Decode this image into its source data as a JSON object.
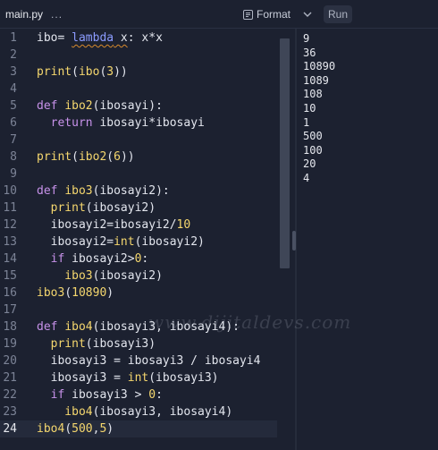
{
  "tab": {
    "filename": "main.py",
    "more": "...",
    "caret": "⌄"
  },
  "toolbar": {
    "format_label": "Format",
    "run_label": "Run"
  },
  "editor": {
    "lines": [
      {
        "n": "1",
        "tokens": [
          {
            "t": "ibo",
            "c": "op"
          },
          {
            "t": "= ",
            "c": "op"
          },
          {
            "t": "lambda",
            "c": "lam sq"
          },
          {
            "t": " x",
            "c": "op sq"
          },
          {
            "t": ": x*x",
            "c": "op"
          }
        ]
      },
      {
        "n": "2",
        "tokens": []
      },
      {
        "n": "3",
        "tokens": [
          {
            "t": "print",
            "c": "fn"
          },
          {
            "t": "(",
            "c": "op"
          },
          {
            "t": "ibo",
            "c": "fn"
          },
          {
            "t": "(",
            "c": "op"
          },
          {
            "t": "3",
            "c": "num"
          },
          {
            "t": "))",
            "c": "op"
          }
        ]
      },
      {
        "n": "4",
        "tokens": []
      },
      {
        "n": "5",
        "tokens": [
          {
            "t": "def ",
            "c": "kw"
          },
          {
            "t": "ibo2",
            "c": "fn"
          },
          {
            "t": "(ibosayi):",
            "c": "op"
          }
        ]
      },
      {
        "n": "6",
        "tokens": [
          {
            "t": "  return ",
            "c": "kw"
          },
          {
            "t": "ibosayi*ibosayi",
            "c": "op"
          }
        ]
      },
      {
        "n": "7",
        "tokens": []
      },
      {
        "n": "8",
        "tokens": [
          {
            "t": "print",
            "c": "fn"
          },
          {
            "t": "(",
            "c": "op"
          },
          {
            "t": "ibo2",
            "c": "fn"
          },
          {
            "t": "(",
            "c": "op"
          },
          {
            "t": "6",
            "c": "num"
          },
          {
            "t": "))",
            "c": "op"
          }
        ]
      },
      {
        "n": "9",
        "tokens": []
      },
      {
        "n": "10",
        "tokens": [
          {
            "t": "def ",
            "c": "kw"
          },
          {
            "t": "ibo3",
            "c": "fn"
          },
          {
            "t": "(ibosayi2):",
            "c": "op"
          }
        ]
      },
      {
        "n": "11",
        "tokens": [
          {
            "t": "  print",
            "c": "fn"
          },
          {
            "t": "(ibosayi2)",
            "c": "op"
          }
        ]
      },
      {
        "n": "12",
        "tokens": [
          {
            "t": "  ibosayi2=ibosayi2/",
            "c": "op"
          },
          {
            "t": "10",
            "c": "num"
          }
        ]
      },
      {
        "n": "13",
        "tokens": [
          {
            "t": "  ibosayi2=",
            "c": "op"
          },
          {
            "t": "int",
            "c": "fn"
          },
          {
            "t": "(ibosayi2)",
            "c": "op"
          }
        ]
      },
      {
        "n": "14",
        "tokens": [
          {
            "t": "  if ",
            "c": "kw"
          },
          {
            "t": "ibosayi2>",
            "c": "op"
          },
          {
            "t": "0",
            "c": "num"
          },
          {
            "t": ":",
            "c": "op"
          }
        ]
      },
      {
        "n": "15",
        "tokens": [
          {
            "t": "    ibo3",
            "c": "fn"
          },
          {
            "t": "(ibosayi2)",
            "c": "op"
          }
        ]
      },
      {
        "n": "16",
        "tokens": [
          {
            "t": "ibo3",
            "c": "fn"
          },
          {
            "t": "(",
            "c": "op"
          },
          {
            "t": "10890",
            "c": "num"
          },
          {
            "t": ")",
            "c": "op"
          }
        ]
      },
      {
        "n": "17",
        "tokens": []
      },
      {
        "n": "18",
        "tokens": [
          {
            "t": "def ",
            "c": "kw"
          },
          {
            "t": "ibo4",
            "c": "fn"
          },
          {
            "t": "(ibosayi3, ibosayi4):",
            "c": "op"
          }
        ]
      },
      {
        "n": "19",
        "tokens": [
          {
            "t": "  print",
            "c": "fn"
          },
          {
            "t": "(ibosayi3)",
            "c": "op"
          }
        ]
      },
      {
        "n": "20",
        "tokens": [
          {
            "t": "  ibosayi3 = ibosayi3 / ibosayi4",
            "c": "op"
          }
        ]
      },
      {
        "n": "21",
        "tokens": [
          {
            "t": "  ibosayi3 = ",
            "c": "op"
          },
          {
            "t": "int",
            "c": "fn"
          },
          {
            "t": "(ibosayi3)",
            "c": "op"
          }
        ]
      },
      {
        "n": "22",
        "tokens": [
          {
            "t": "  if ",
            "c": "kw"
          },
          {
            "t": "ibosayi3 > ",
            "c": "op"
          },
          {
            "t": "0",
            "c": "num"
          },
          {
            "t": ":",
            "c": "op"
          }
        ]
      },
      {
        "n": "23",
        "tokens": [
          {
            "t": "    ibo4",
            "c": "fn"
          },
          {
            "t": "(ibosayi3, ibosayi4)",
            "c": "op"
          }
        ]
      },
      {
        "n": "24",
        "tokens": [
          {
            "t": "ibo4",
            "c": "fn"
          },
          {
            "t": "(",
            "c": "op"
          },
          {
            "t": "500",
            "c": "num"
          },
          {
            "t": ",",
            "c": "op"
          },
          {
            "t": "5",
            "c": "num"
          },
          {
            "t": ")",
            "c": "op"
          }
        ],
        "active": true
      }
    ]
  },
  "console": {
    "output": [
      "9",
      "36",
      "10890",
      "1089",
      "108",
      "10",
      "1",
      "500",
      "100",
      "20",
      "4"
    ]
  },
  "watermark": "www.dijitaldevs.com",
  "colors": {
    "background": "#1c2130",
    "keyword": "#c792ea",
    "function": "#f5d76e",
    "text": "#e3e6ee"
  }
}
